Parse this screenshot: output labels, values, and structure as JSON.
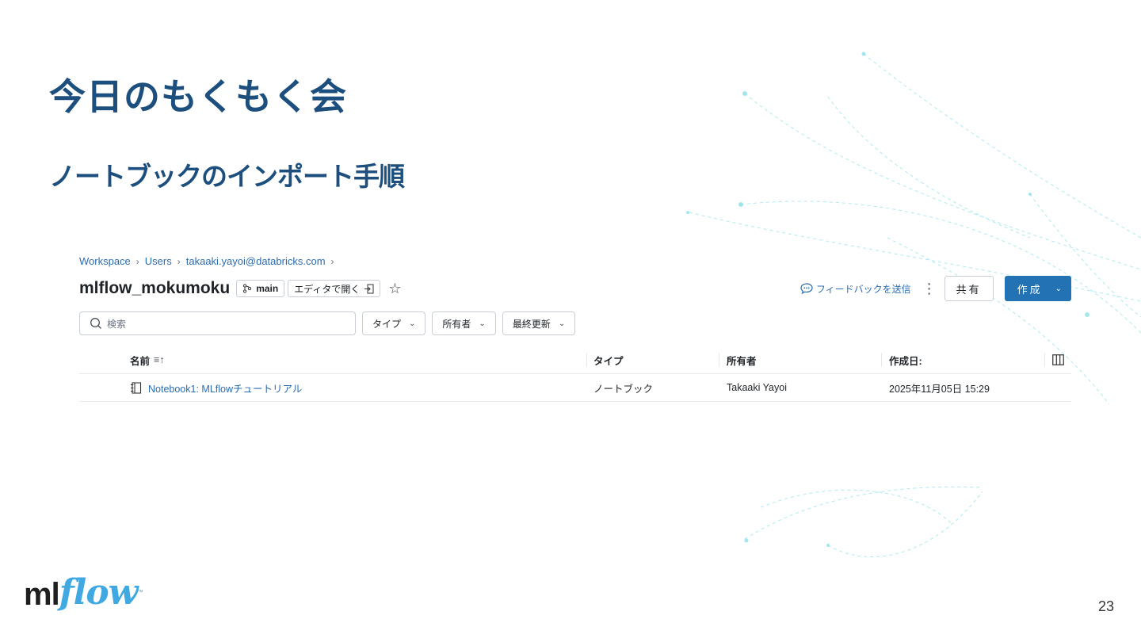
{
  "slide": {
    "title": "今日のもくもく会",
    "subtitle": "ノートブックのインポート手順",
    "page_number": "23",
    "logo": {
      "ml": "ml",
      "flow": "flow",
      "tm": "™"
    }
  },
  "breadcrumb": [
    "Workspace",
    "Users",
    "takaaki.yayoi@databricks.com"
  ],
  "breadcrumb_sep": "›",
  "header": {
    "name": "mlflow_mokumoku",
    "branch": "main",
    "open_editor": "エディタで開く",
    "feedback": "フィードバックを送信",
    "share": "共有",
    "create": "作成"
  },
  "filters": {
    "search_placeholder": "検索",
    "type": "タイプ",
    "owner": "所有者",
    "last_modified": "最終更新"
  },
  "table": {
    "columns": [
      "名前",
      "タイプ",
      "所有者",
      "作成日:"
    ],
    "rows": [
      {
        "name": "Notebook1: MLflowチュートリアル",
        "type": "ノートブック",
        "owner": "Takaaki Yayoi",
        "created": "2025年11月05日 15:29"
      }
    ]
  },
  "colors": {
    "title": "#1d4f7e",
    "link": "#2b6cb0",
    "primary_button": "#2272b4",
    "logo_flow": "#41a9e1"
  }
}
